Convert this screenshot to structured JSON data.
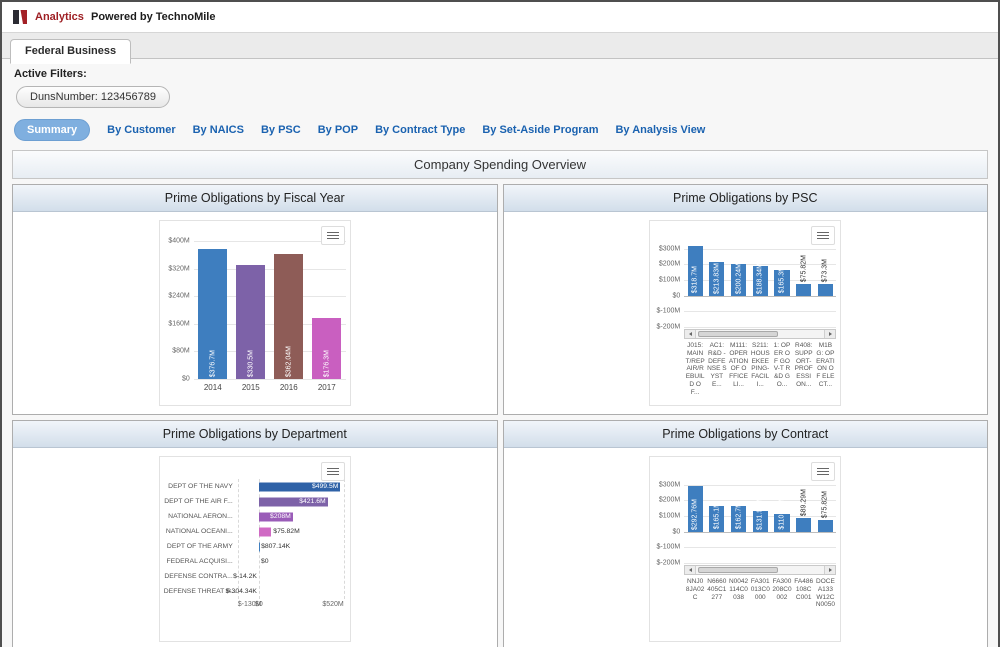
{
  "brand": {
    "analytics": "Analytics",
    "powered": "Powered by TechnoMile"
  },
  "tab": {
    "label": "Federal Business"
  },
  "filters": {
    "title": "Active Filters:",
    "duns": "DunsNumber: 123456789"
  },
  "nav": {
    "items": [
      {
        "label": "Summary",
        "active": true
      },
      {
        "label": "By Customer",
        "active": false
      },
      {
        "label": "By NAICS",
        "active": false
      },
      {
        "label": "By PSC",
        "active": false
      },
      {
        "label": "By POP",
        "active": false
      },
      {
        "label": "By Contract Type",
        "active": false
      },
      {
        "label": "By Set-Aside Program",
        "active": false
      },
      {
        "label": "By Analysis View",
        "active": false
      }
    ]
  },
  "section": {
    "title": "Company Spending Overview"
  },
  "chart_data": [
    {
      "type": "bar",
      "title": "Prime Obligations by Fiscal Year",
      "categories": [
        "2014",
        "2015",
        "2016",
        "2017"
      ],
      "values": [
        376.7,
        330.5,
        362.04,
        176.3
      ],
      "value_labels": [
        "$376.7M",
        "$330.5M",
        "$362.04M",
        "$176.3M"
      ],
      "label_pos": [
        "in",
        "in",
        "in",
        "in"
      ],
      "bar_colors": [
        "#3e7ebf",
        "#7d62a8",
        "#8e5c57",
        "#c95fc0"
      ],
      "ylabel": "",
      "xlabel": "",
      "ylim": [
        0,
        400
      ],
      "yticks": [
        {
          "v": 0,
          "label": "$0"
        },
        {
          "v": 80,
          "label": "$80M"
        },
        {
          "v": 160,
          "label": "$160M"
        },
        {
          "v": 240,
          "label": "$240M"
        },
        {
          "v": 320,
          "label": "$320M"
        },
        {
          "v": 400,
          "label": "$400M"
        }
      ],
      "grid": true,
      "legend": false,
      "scrollbar": false
    },
    {
      "type": "bar",
      "title": "Prime Obligations by PSC",
      "categories": [
        "J015: MAINT/REP AIR/REBUILD OF...",
        "AC1: R&D - DEFENSE SYSTE...",
        "M111: OPERATION OF OFFICE LI...",
        "S211: HOUSEKEEPING- FACILI...",
        "1: OPER OF GOV-T R&D GO...",
        "R408: SUPPORT- PROFESSION...",
        "M1BG: OPERATION OF ELECT..."
      ],
      "values": [
        318.7,
        213.83,
        200.24,
        188.34,
        165.3,
        75.82,
        73.3
      ],
      "value_labels": [
        "$318.7M",
        "$213.83M",
        "$200.24M",
        "$188.34M",
        "$165.3M",
        "$75.82M",
        "$73.3M"
      ],
      "label_pos": [
        "in",
        "in",
        "in",
        "in",
        "in",
        "above",
        "above"
      ],
      "bar_colors": [
        "#3e7ebf"
      ],
      "ylabel": "",
      "xlabel": "",
      "ylim": [
        -200,
        350
      ],
      "yticks": [
        {
          "v": 300,
          "label": "$300M"
        },
        {
          "v": 200,
          "label": "$200M"
        },
        {
          "v": 100,
          "label": "$100M"
        },
        {
          "v": 0,
          "label": "$0"
        },
        {
          "v": -100,
          "label": "$-100M"
        },
        {
          "v": -200,
          "label": "$-200M"
        }
      ],
      "grid": true,
      "legend": false,
      "scrollbar": true
    },
    {
      "type": "hbar",
      "title": "Prime Obligations by Department",
      "categories": [
        "DEPT OF THE NAVY",
        "DEPT OF THE AIR F...",
        "NATIONAL AERON...",
        "NATIONAL OCEANI...",
        "DEPT OF THE ARMY",
        "FEDERAL ACQUISI...",
        "DEFENSE CONTRA...",
        "DEFENSE THREAT R..."
      ],
      "values": [
        499.5,
        421.6,
        208,
        75.82,
        0.80714,
        0,
        -0.0142,
        -0.30434
      ],
      "value_labels": [
        "$499.5M",
        "$421.6M",
        "$208M",
        "$75.82M",
        "$807.14K",
        "$0",
        "$-14.2K",
        "$-304.34K"
      ],
      "label_pos": [
        "in",
        "in",
        "in",
        "out",
        "out",
        "out",
        "outneg",
        "outneg"
      ],
      "bar_colors": [
        "#2f62a7",
        "#7d62a8",
        "#9a5cb8",
        "#d06ac4",
        "#3e7ebf",
        "#3e7ebf",
        "#3e7ebf",
        "#3e7ebf"
      ],
      "ylabel": "",
      "xlabel": "",
      "xlim": [
        -130,
        520
      ],
      "xticks": [
        {
          "v": -130,
          "label": "$-130M"
        },
        {
          "v": 0,
          "label": "$0"
        },
        {
          "v": 520,
          "label": "$520M"
        }
      ],
      "grid": true,
      "legend": false,
      "scrollbar": false
    },
    {
      "type": "bar",
      "title": "Prime Obligations by Contract",
      "categories": [
        "NNJ08JA02C",
        "N6660405C1277",
        "N0042114C0038",
        "FA301013C0000",
        "FA300208C0002",
        "FA486108CC001",
        "DOCEA133W12CN0050"
      ],
      "values": [
        292.76,
        165.1,
        162.7,
        131.94,
        110.91,
        89.29,
        75.82
      ],
      "value_labels": [
        "$292.76M",
        "$165.1M",
        "$162.7M",
        "$131.94M",
        "$110.91M",
        "$89.29M",
        "$75.82M"
      ],
      "label_pos": [
        "in",
        "in",
        "in",
        "in",
        "in",
        "above",
        "above"
      ],
      "bar_colors": [
        "#3e7ebf"
      ],
      "ylabel": "",
      "xlabel": "",
      "ylim": [
        -200,
        350
      ],
      "yticks": [
        {
          "v": 300,
          "label": "$300M"
        },
        {
          "v": 200,
          "label": "$200M"
        },
        {
          "v": 100,
          "label": "$100M"
        },
        {
          "v": 0,
          "label": "$0"
        },
        {
          "v": -100,
          "label": "$-100M"
        },
        {
          "v": -200,
          "label": "$-200M"
        }
      ],
      "grid": true,
      "legend": false,
      "scrollbar": true
    }
  ]
}
